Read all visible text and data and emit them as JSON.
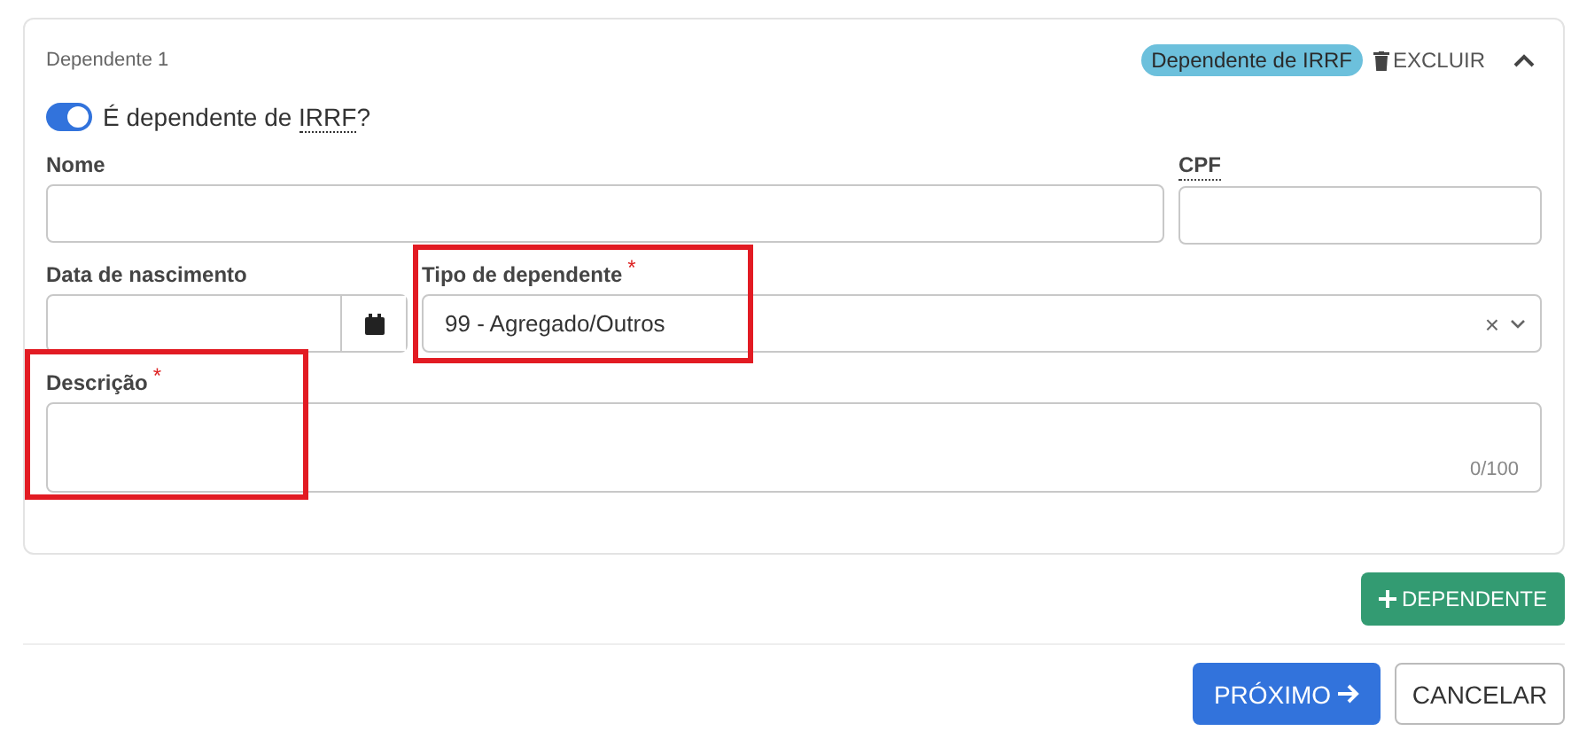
{
  "card": {
    "title": "Dependente 1",
    "badge": "Dependente de IRRF",
    "delete_button": "EXCLUIR",
    "expanded": true,
    "toggle": {
      "on": true,
      "label_before": "É dependente de ",
      "abbreviation": "IRRF",
      "label_after": "?"
    },
    "form_rows": [
      {
        "fields": [
          {
            "kind": "text",
            "label": "Nome",
            "abbreviated": false,
            "highlighted": false
          },
          {
            "kind": "text",
            "label": "CPF",
            "abbreviated": true,
            "highlighted": false
          }
        ]
      },
      {
        "fields": [
          {
            "kind": "date",
            "label": "Data de nascimento",
            "abbreviated": false,
            "highlighted": false
          },
          {
            "kind": "select",
            "label": "Tipo de dependente",
            "required_mark": "*",
            "value": "99 - Agregado/Outros",
            "clear": "×",
            "abbreviated": false,
            "highlighted": true
          }
        ]
      },
      {
        "fields": [
          {
            "kind": "textarea",
            "label": "Descrição",
            "required_mark": "*",
            "counter": "0/100",
            "abbreviated": false,
            "highlighted": true
          }
        ]
      }
    ]
  },
  "add_button": "DEPENDENTE",
  "buttons": [
    {
      "kind": "primary",
      "label": "PRÓXIMO"
    },
    {
      "kind": "secondary",
      "label": "CANCELAR"
    }
  ]
}
